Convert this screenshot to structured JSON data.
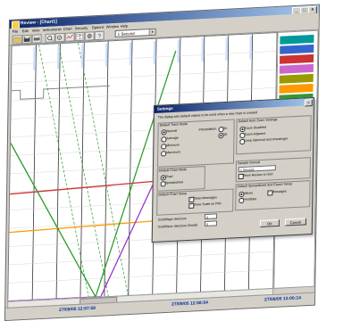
{
  "window": {
    "title": "Review - [Chart1]",
    "menu": [
      "File",
      "Edit",
      "View",
      "Instruments",
      "Chart",
      "Security",
      "Options",
      "Window",
      "Help"
    ],
    "timebase": "1 Second",
    "timestamps_bottom": [
      "27/09/05 12:57:58",
      "27/09/05 12:58:54",
      "27/09/05 13:00:14"
    ]
  },
  "colors": {
    "accent": "#0a246a",
    "trace_green": "#2c9c2c",
    "trace_red": "#cc3333",
    "trace_orange": "#ff9900",
    "trace_magenta": "#9933cc",
    "trace_gray": "#888888"
  },
  "chart_data": {
    "type": "line",
    "series": [
      {
        "name": "",
        "color": "#ff9900",
        "x": [
          0,
          1
        ],
        "y": [
          0.27,
          0.3
        ]
      },
      {
        "name": "",
        "color": "#cc3333",
        "x": [
          0,
          1
        ],
        "y": [
          0.42,
          0.46
        ]
      },
      {
        "name": "",
        "color": "#9933cc",
        "x": [
          0.0,
          0.35,
          0.55
        ],
        "y": [
          0.0,
          0.0,
          0.45
        ]
      },
      {
        "name": "",
        "color": "#2c9c2c",
        "x": [
          0.0,
          0.33,
          0.62
        ],
        "y": [
          0.62,
          0.0,
          0.95
        ]
      }
    ],
    "grid": true
  },
  "trend_panel": {
    "tags": [
      {
        "value": "",
        "bg": "#009999"
      },
      {
        "value": "",
        "bg": "#3366cc"
      },
      {
        "value": "",
        "bg": "#cc3333"
      },
      {
        "value": "",
        "bg": "#cc66cc"
      },
      {
        "value": "",
        "bg": "#999900"
      },
      {
        "value": "",
        "bg": "#ff9900"
      },
      {
        "value": "",
        "bg": "#339933"
      },
      {
        "value": "",
        "bg": "#666699"
      }
    ]
  },
  "dialog": {
    "title": "Settings",
    "intro": "The dialog sets default values to be used when a new chart is created.",
    "trace_mode": {
      "label": "Default Trace Mode",
      "options": [
        "Normal",
        "Average",
        "Minimum",
        "Maximum"
      ],
      "selected": 0
    },
    "interpolation": {
      "label": "Interpolation",
      "options": [
        "On",
        "Off"
      ],
      "selected": 1
    },
    "zoom": {
      "label": "Default Auto Zoom Settings",
      "options": [
        "Zoom Disabled",
        "Zoom Adjacent",
        "Keep historical and timeslinger"
      ],
      "selected": 0
    },
    "chart_mode": {
      "label": "Default Chart Mode",
      "options": [
        "Chart",
        "Spreadsheet"
      ],
      "selected": 0
    },
    "chart_setup": {
      "label": "Default Chart Setup",
      "checks": [
        {
          "label": "Show Messages",
          "on": true
        },
        {
          "label": "Show Scale on Plot",
          "on": true
        }
      ]
    },
    "sample": {
      "label": "Sample Interval",
      "value": "1 Second",
      "check": "Show Review on Exit"
    },
    "export": {
      "label": "Default Spreadsheet and Export Setup",
      "options": [
        "Values",
        "Messages",
        "Pen/Date"
      ],
      "selected": 0
    },
    "gridlines": {
      "label": "Grid/Major divisions",
      "value": "4"
    },
    "gridlines_minor": {
      "label": "Grid/Minor divisions (Small)",
      "value": "5"
    },
    "ok": "OK",
    "cancel": "Cancel"
  }
}
